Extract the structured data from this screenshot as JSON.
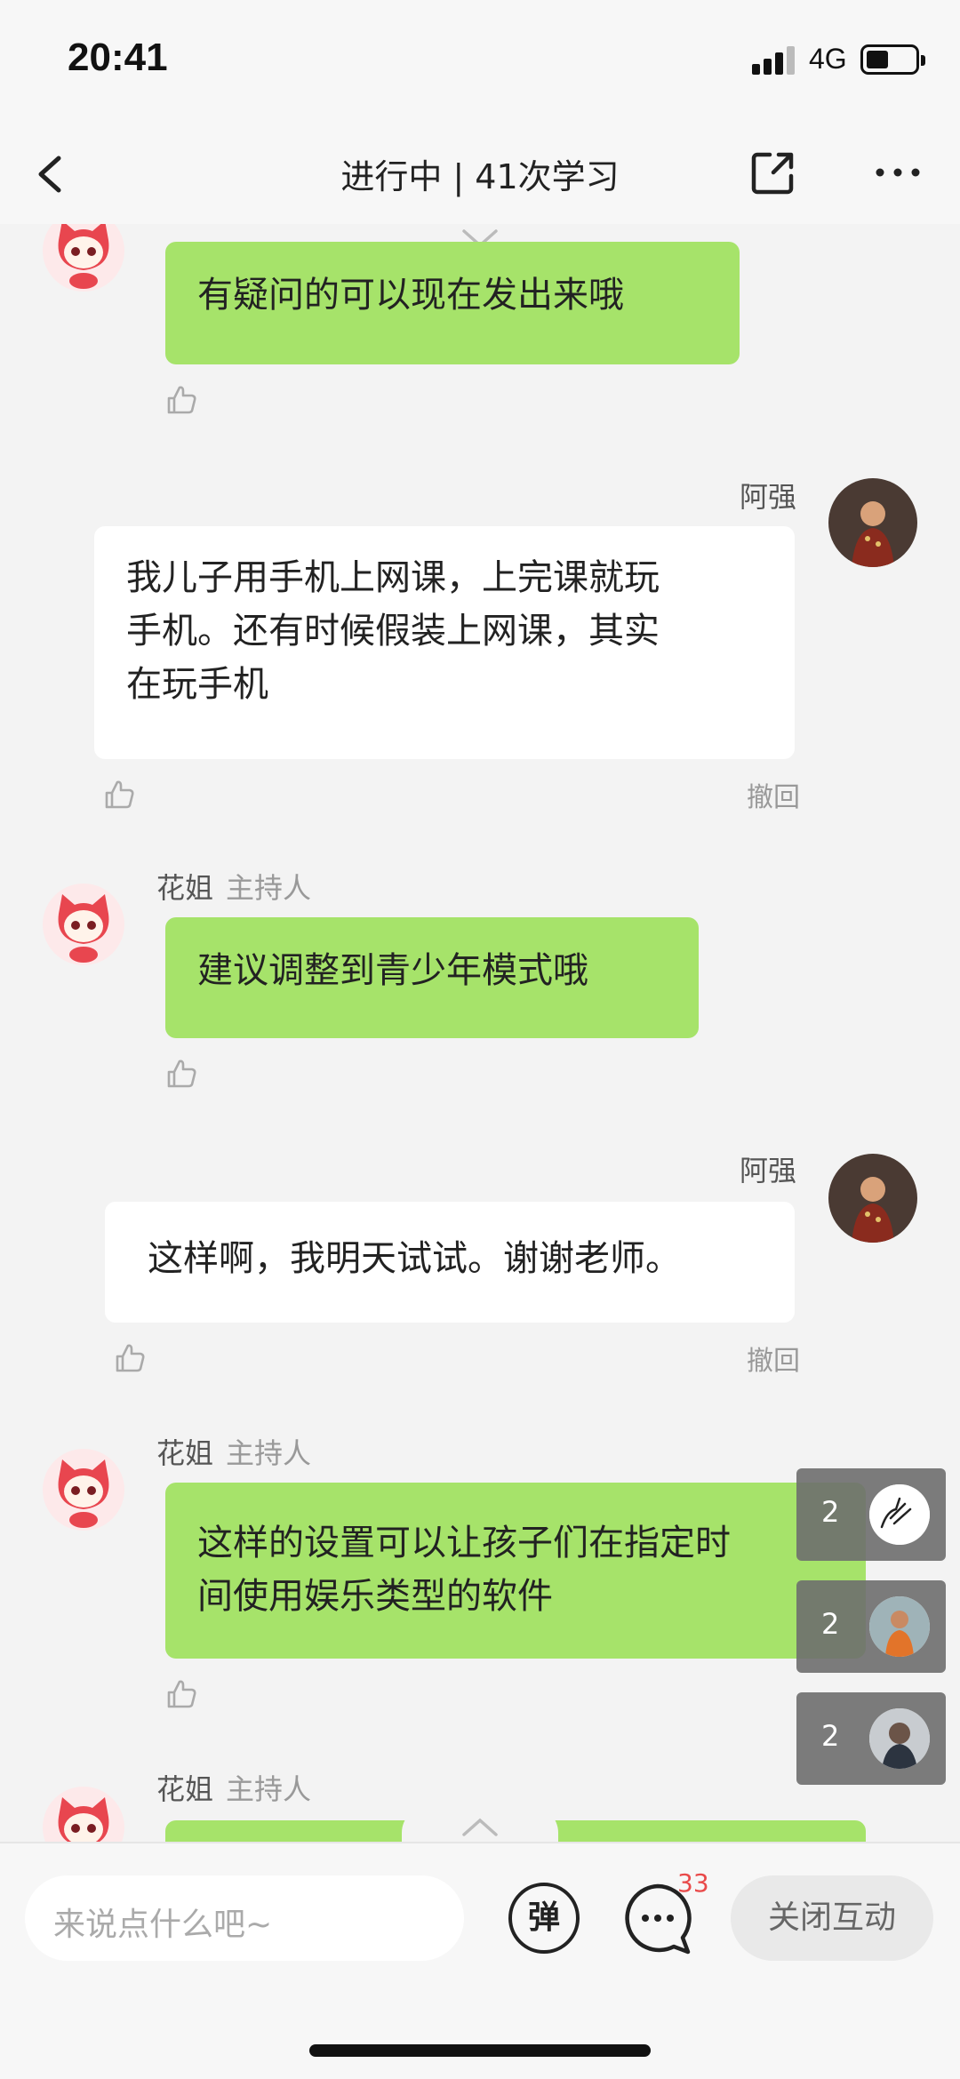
{
  "status_bar": {
    "time": "20:41",
    "network": "4G"
  },
  "nav": {
    "title": "进行中 | 41次学习"
  },
  "messages": [
    {
      "sender": "",
      "role": "",
      "text": "有疑问的可以现在发出来哦",
      "type": "host"
    },
    {
      "sender": "阿强",
      "text": "我儿子用手机上网课，上完课就玩手机。还有时候假装上网课，其实在玩手机",
      "lines": [
        "我儿子用手机上网课，上完课就玩",
        "手机。还有时候假装上网课，其实",
        "在玩手机"
      ],
      "type": "self",
      "recall": "撤回"
    },
    {
      "sender": "花姐",
      "role": "主持人",
      "text": "建议调整到青少年模式哦",
      "type": "host"
    },
    {
      "sender": "阿强",
      "text": "这样啊，我明天试试。谢谢老师。",
      "type": "self",
      "recall": "撤回"
    },
    {
      "sender": "花姐",
      "role": "主持人",
      "lines": [
        "这样的设置可以让孩子们在指定时",
        "间使用娱乐类型的软件"
      ],
      "type": "host"
    },
    {
      "sender": "花姐",
      "role": "主持人",
      "text": "",
      "type": "host"
    }
  ],
  "floating_listeners": [
    {
      "count": "2"
    },
    {
      "count": "2"
    },
    {
      "count": "2"
    }
  ],
  "bottom_bar": {
    "input_placeholder": "来说点什么吧~",
    "danmu_label": "弹",
    "comment_count": "33",
    "close_label": "关闭互动"
  },
  "colors": {
    "host_bubble": "#a6e36a",
    "self_bubble": "#ffffff",
    "badge": "#e94a4a",
    "mascot": "#e8464f"
  }
}
